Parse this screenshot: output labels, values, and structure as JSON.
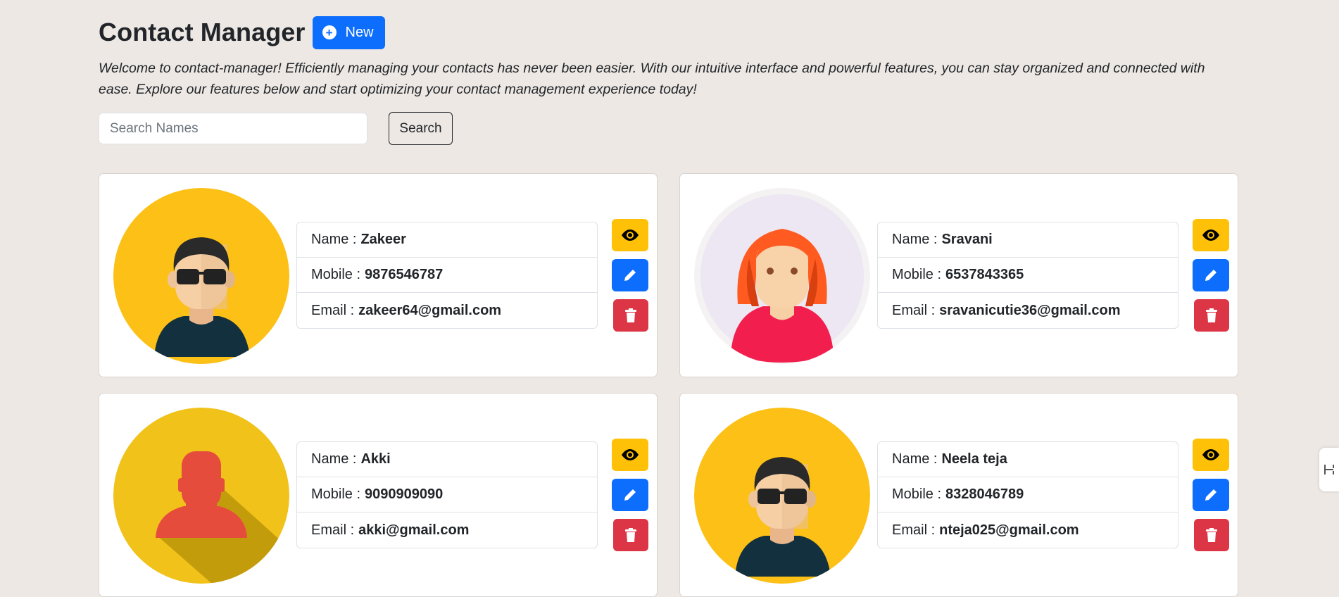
{
  "header": {
    "title": "Contact Manager",
    "new_button_label": "New"
  },
  "intro": "Welcome to contact-manager! Efficiently managing your contacts has never been easier. With our intuitive interface and powerful features, you can stay organized and connected with ease. Explore our features below and start optimizing your contact management experience today!",
  "search": {
    "placeholder": "Search Names",
    "value": "",
    "button_label": "Search"
  },
  "labels": {
    "name": "Name :",
    "mobile": "Mobile :",
    "email": "Email :"
  },
  "contacts": [
    {
      "name": "Zakeer",
      "mobile": "9876546787",
      "email": "zakeer64@gmail.com",
      "avatar": "man-sunglasses-avatar"
    },
    {
      "name": "Sravani",
      "mobile": "6537843365",
      "email": "sravanicutie36@gmail.com",
      "avatar": "woman-red-hair-avatar"
    },
    {
      "name": "Akki",
      "mobile": "9090909090",
      "email": "akki@gmail.com",
      "avatar": "silhouette-avatar"
    },
    {
      "name": "Neela teja",
      "mobile": "8328046789",
      "email": "nteja025@gmail.com",
      "avatar": "man-sunglasses-avatar"
    }
  ],
  "colors": {
    "background": "#ede8e4",
    "primary": "#0d6efd",
    "warning": "#ffc107",
    "danger": "#dc3545"
  },
  "icons": {
    "view": "eye-icon",
    "edit": "pencil-icon",
    "delete": "trash-icon",
    "new": "plus-circle-icon"
  }
}
